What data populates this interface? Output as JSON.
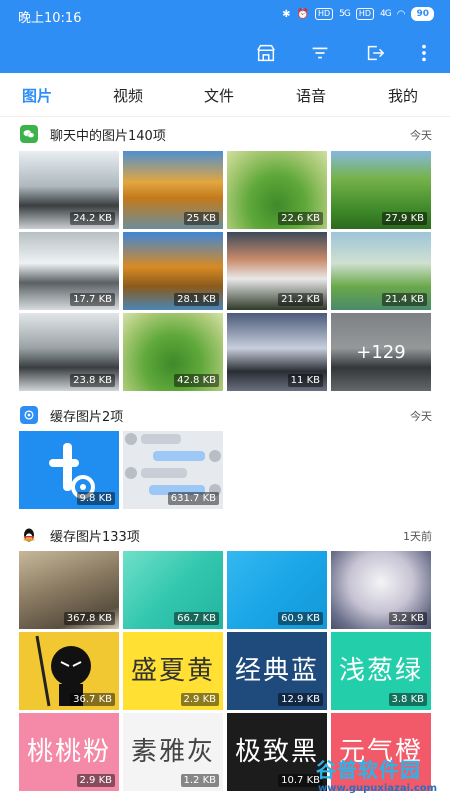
{
  "statusbar": {
    "time": "晚上10:16",
    "hd1": "HD",
    "sig1": "5G",
    "hd2": "HD",
    "sig2": "4G",
    "battery": "90"
  },
  "icons": {
    "cart": "store-icon",
    "filter": "filter-icon",
    "export": "export-icon",
    "more": "more-vertical-icon"
  },
  "tabs": [
    {
      "label": "图片",
      "active": true
    },
    {
      "label": "视频",
      "active": false
    },
    {
      "label": "文件",
      "active": false
    },
    {
      "label": "语音",
      "active": false
    },
    {
      "label": "我的",
      "active": false
    }
  ],
  "sections": [
    {
      "title": "聊天中的图片140项",
      "time": "今天",
      "icon": "wechat-icon",
      "icon_color": "#3cb34a",
      "items": [
        {
          "size": "24.2 KB"
        },
        {
          "size": "25 KB"
        },
        {
          "size": "22.6 KB"
        },
        {
          "size": "27.9 KB"
        },
        {
          "size": "17.7 KB"
        },
        {
          "size": "28.1 KB"
        },
        {
          "size": "21.2 KB"
        },
        {
          "size": "21.4 KB"
        },
        {
          "size": "23.8 KB"
        },
        {
          "size": "42.8 KB"
        },
        {
          "size": "11 KB"
        },
        {
          "size": "",
          "more": "+129"
        }
      ]
    },
    {
      "title": "缓存图片2项",
      "time": "今天",
      "icon": "app-icon",
      "icon_color": "#2f8ef4",
      "items": [
        {
          "size": "9.8 KB"
        },
        {
          "size": "631.7 KB"
        }
      ]
    },
    {
      "title": "缓存图片133项",
      "time": "1天前",
      "icon": "qq-penguin-icon",
      "icon_color": "#111111",
      "items": [
        {
          "size": "367.8 KB"
        },
        {
          "size": "66.7 KB"
        },
        {
          "size": "60.9 KB"
        },
        {
          "size": "3.2 KB"
        },
        {
          "size": "36.7 KB"
        },
        {
          "size": "2.9 KB",
          "text": "盛夏黄"
        },
        {
          "size": "12.9 KB",
          "text": "经典蓝"
        },
        {
          "size": "3.8 KB",
          "text": "浅葱绿"
        },
        {
          "size": "2.9 KB",
          "text": "桃桃粉"
        },
        {
          "size": "1.2 KB",
          "text": "素雅灰"
        },
        {
          "size": "10.7 KB",
          "text": "极致黑"
        },
        {
          "size": "",
          "text": "元气橙"
        }
      ]
    }
  ],
  "watermark": {
    "title": "谷普软件园",
    "url": "www.gupuxiazai.com"
  },
  "colors": {
    "accent": "#2f8ef4"
  }
}
